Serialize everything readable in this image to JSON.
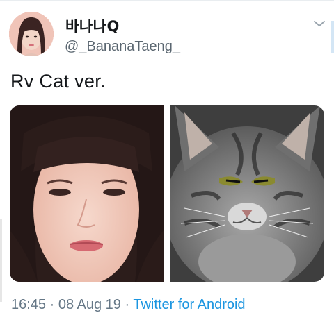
{
  "tweet": {
    "display_name": "바나나Q",
    "handle": "@_BananaTaeng_",
    "text": "Rv Cat ver.",
    "time": "16:45",
    "separator_1": " · ",
    "date": "08 Aug 19",
    "separator_2": " · ",
    "source": "Twitter for Android"
  },
  "icons": {
    "menu": "chevron-down-icon"
  },
  "colors": {
    "link": "#1b95e0",
    "meta_text": "#657786",
    "primary_text": "#14171a"
  }
}
